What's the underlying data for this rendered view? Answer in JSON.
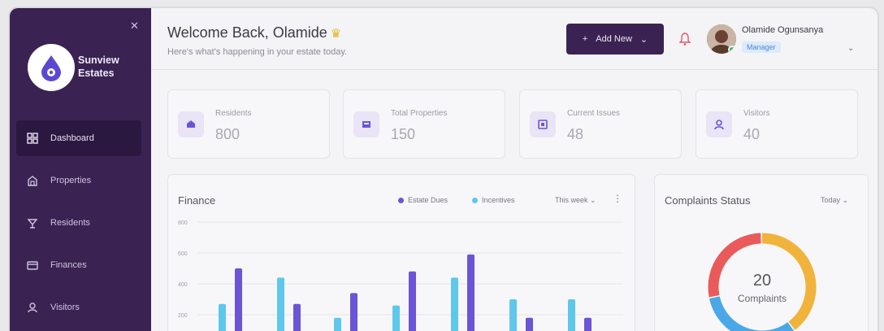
{
  "sidebar": {
    "brand": "Sunview Estates",
    "items": [
      {
        "label": "Dashboard",
        "icon": "grid-icon",
        "active": true
      },
      {
        "label": "Properties",
        "icon": "building-icon",
        "active": false
      },
      {
        "label": "Residents",
        "icon": "users-icon",
        "active": false
      },
      {
        "label": "Finances",
        "icon": "wallet-icon",
        "active": false
      },
      {
        "label": "Visitors",
        "icon": "user-icon",
        "active": false
      }
    ]
  },
  "header": {
    "welcome": "Welcome Back, Olamide",
    "subtitle": "Here's what's happening in your estate today.",
    "add_button": "Add New",
    "user_name": "Olamide Ogunsanya",
    "user_role": "Manager"
  },
  "stats": [
    {
      "label": "Residents",
      "value": "800",
      "icon": "home-icon"
    },
    {
      "label": "Total Properties",
      "value": "150",
      "icon": "property-icon"
    },
    {
      "label": "Current Issues",
      "value": "48",
      "icon": "issues-icon"
    },
    {
      "label": "Visitors",
      "value": "40",
      "icon": "visitor-icon"
    }
  ],
  "finance": {
    "title": "Finance",
    "period": "This week",
    "legend": [
      "Estate Dues",
      "Incentives"
    ]
  },
  "complaints": {
    "title": "Complaints Status",
    "period": "Today",
    "count": "20",
    "label": "Complaints"
  },
  "colors": {
    "accent": "#3a2352",
    "primary_bar": "#6b54d6",
    "secondary_bar": "#5ec8ec"
  },
  "chart_data": [
    {
      "type": "bar",
      "title": "Finance",
      "ylabels": [
        "800",
        "600",
        "400",
        "200"
      ],
      "series": [
        {
          "name": "Incentives",
          "values": [
            270,
            440,
            180,
            260,
            440,
            300,
            300
          ]
        },
        {
          "name": "Estate Dues",
          "values": [
            500,
            270,
            340,
            480,
            590,
            180,
            180
          ]
        }
      ],
      "legend_position": "top-right"
    },
    {
      "type": "pie",
      "title": "Complaints Status",
      "values": [
        40,
        32,
        28
      ],
      "colors": [
        "#f0b43c",
        "#4aa8e6",
        "#ea5a5a"
      ]
    }
  ]
}
